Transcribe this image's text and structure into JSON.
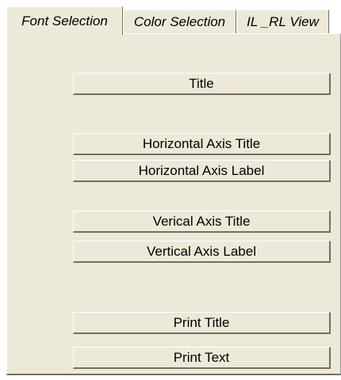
{
  "tabs": [
    {
      "label": "Font Selection",
      "active": true
    },
    {
      "label": "Color Selection",
      "active": false
    },
    {
      "label": "IL _RL View",
      "active": false
    }
  ],
  "buttons": {
    "title": "Title",
    "horizontal_axis_title": "Horizontal Axis Title",
    "horizontal_axis_label": "Horizontal Axis Label",
    "vertical_axis_title": "Verical Axis Title",
    "vertical_axis_label": "Vertical Axis Label",
    "print_title": "Print Title",
    "print_text": "Print Text"
  },
  "colors": {
    "face": "#ece9d8",
    "highlight": "#ffffff",
    "shadow": "#716f64"
  }
}
